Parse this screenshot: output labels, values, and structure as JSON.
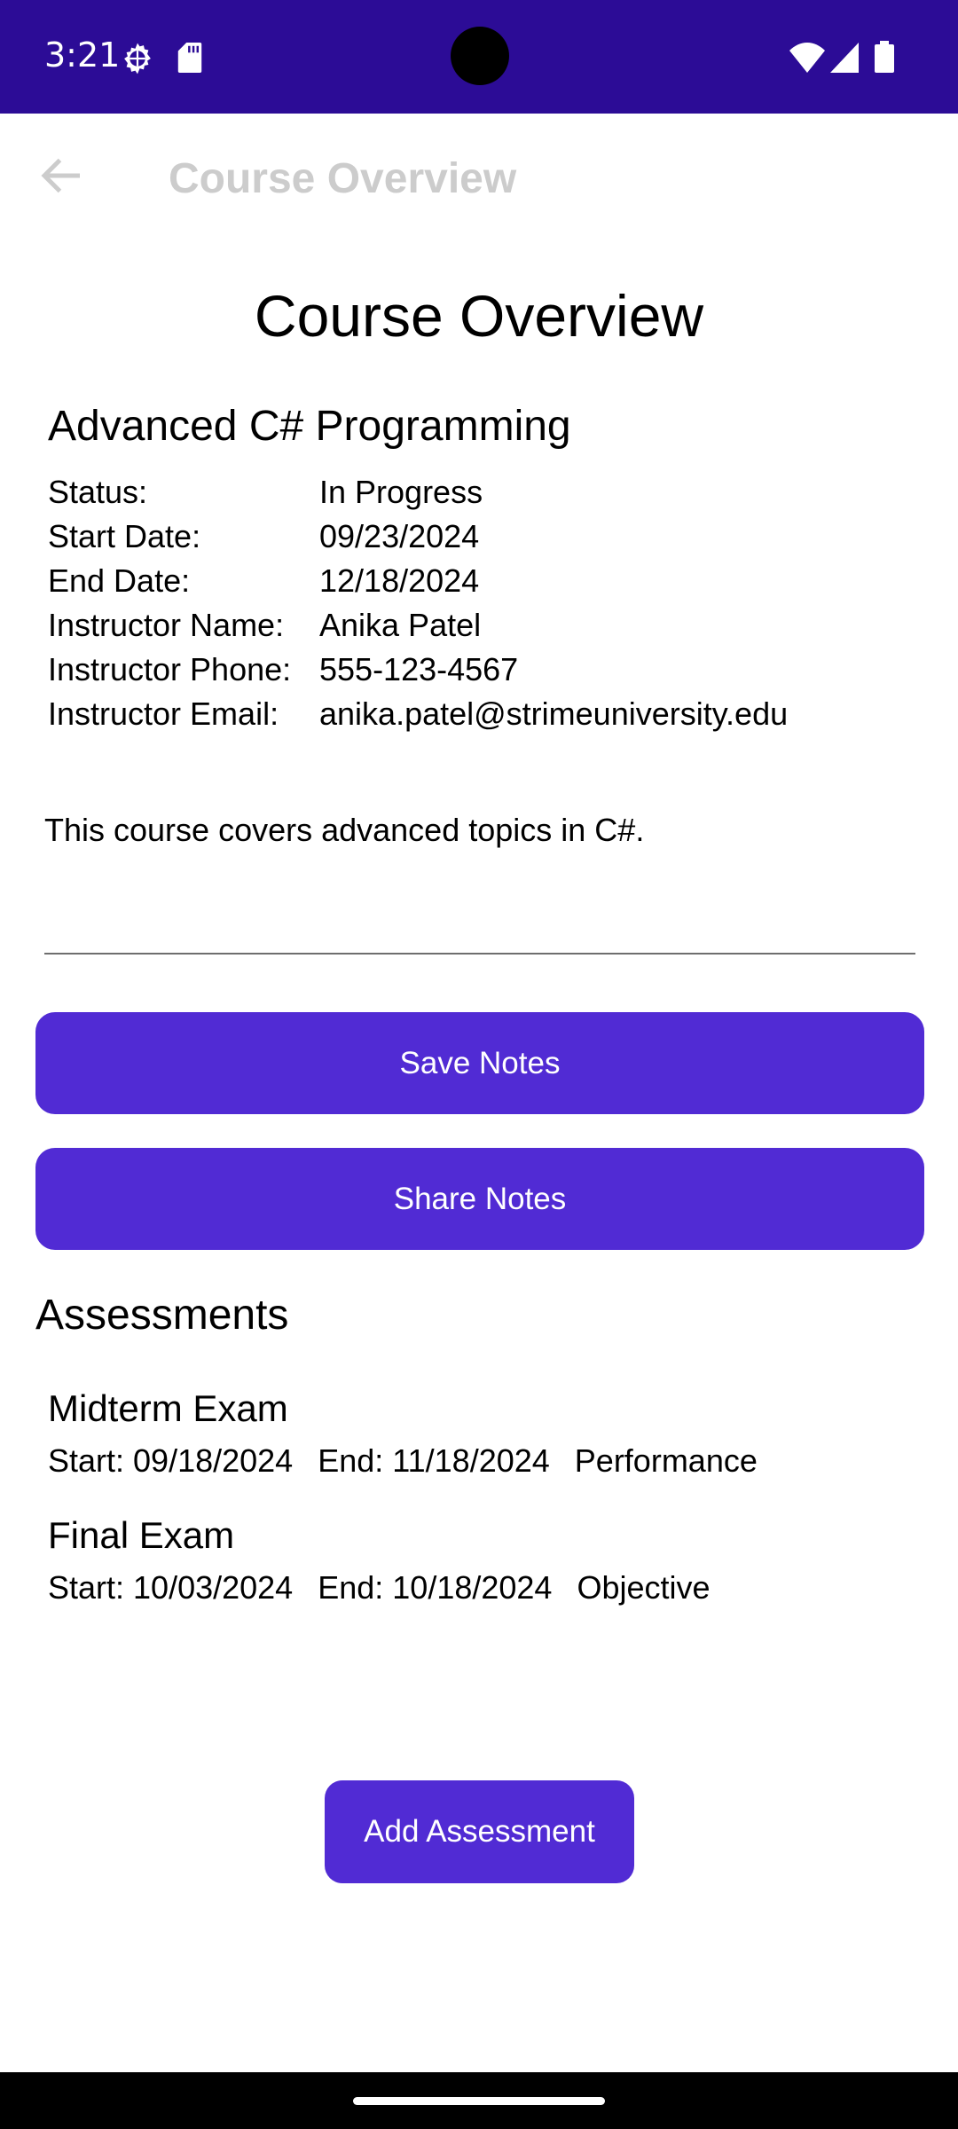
{
  "status_bar": {
    "time": "3:21",
    "left_icons": [
      "gear-icon",
      "sd-card-icon"
    ],
    "right_icons": [
      "wifi-icon",
      "signal-icon",
      "battery-icon"
    ]
  },
  "app_bar": {
    "back_icon": "arrow-left-icon",
    "title": "Course Overview"
  },
  "page": {
    "title": "Course Overview",
    "course_name": "Advanced C# Programming",
    "details": [
      {
        "label": "Status:",
        "value": "In Progress"
      },
      {
        "label": "Start Date:",
        "value": "09/23/2024"
      },
      {
        "label": "End Date:",
        "value": "12/18/2024"
      },
      {
        "label": "Instructor Name:",
        "value": "Anika Patel"
      },
      {
        "label": "Instructor Phone:",
        "value": "555-123-4567"
      },
      {
        "label": "Instructor Email:",
        "value": "anika.patel@strimeuniversity.edu"
      }
    ],
    "notes": "This course covers advanced topics in C#.",
    "save_label": "Save Notes",
    "share_label": "Share Notes"
  },
  "assessments": {
    "heading": "Assessments",
    "items": [
      {
        "name": "Midterm Exam",
        "start": "Start: 09/18/2024",
        "end": "End: 11/18/2024",
        "type": "Performance"
      },
      {
        "name": "Final Exam",
        "start": "Start: 10/03/2024",
        "end": "End: 10/18/2024",
        "type": "Objective"
      }
    ],
    "add_label": "Add Assessment"
  },
  "colors": {
    "status_bar": "#2c0c96",
    "primary": "#512bd4",
    "app_title": "#cccccc"
  }
}
